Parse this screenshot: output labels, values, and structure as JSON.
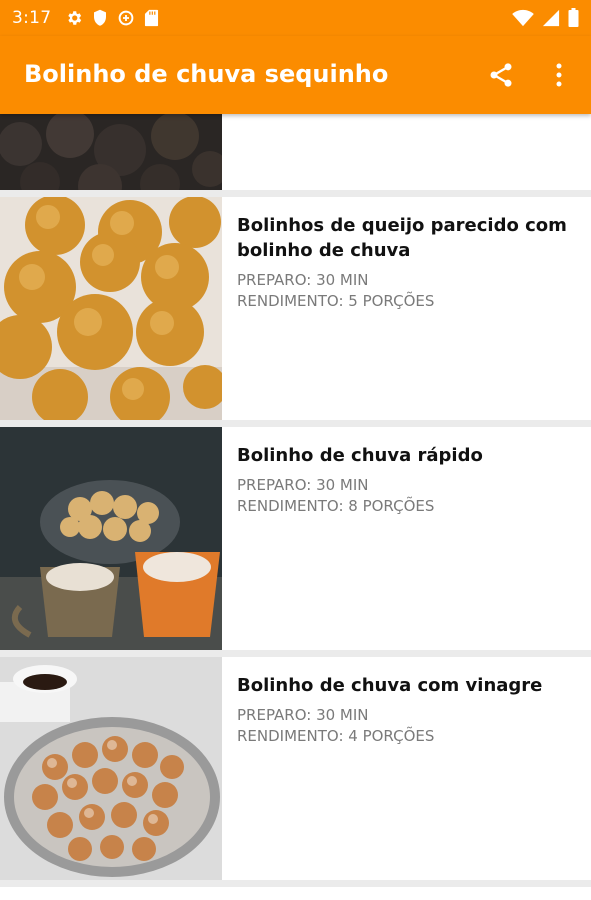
{
  "status_bar": {
    "time": "3:17",
    "left_icons": [
      "gear-icon",
      "shield-icon",
      "data-saver-icon",
      "sd-card-icon"
    ],
    "right_icons": [
      "wifi-icon",
      "cell-signal-icon",
      "battery-icon"
    ]
  },
  "app_bar": {
    "title": "Bolinho de chuva sequinho",
    "actions": [
      "share-icon",
      "more-vert-icon"
    ],
    "background_color": "#fb8c00"
  },
  "recipes": [
    {
      "title": "Bolinhos de queijo parecido com bolinho de chuva",
      "preparo": "PREPARO: 30 MIN",
      "rendimento": "RENDIMENTO: 5 PORÇÕES"
    },
    {
      "title": "Bolinho de chuva rápido",
      "preparo": "PREPARO: 30 MIN",
      "rendimento": "RENDIMENTO: 8 PORÇÕES"
    },
    {
      "title": "Bolinho de chuva com vinagre",
      "preparo": "PREPARO: 30 MIN",
      "rendimento": "RENDIMENTO: 4 PORÇÕES"
    }
  ]
}
